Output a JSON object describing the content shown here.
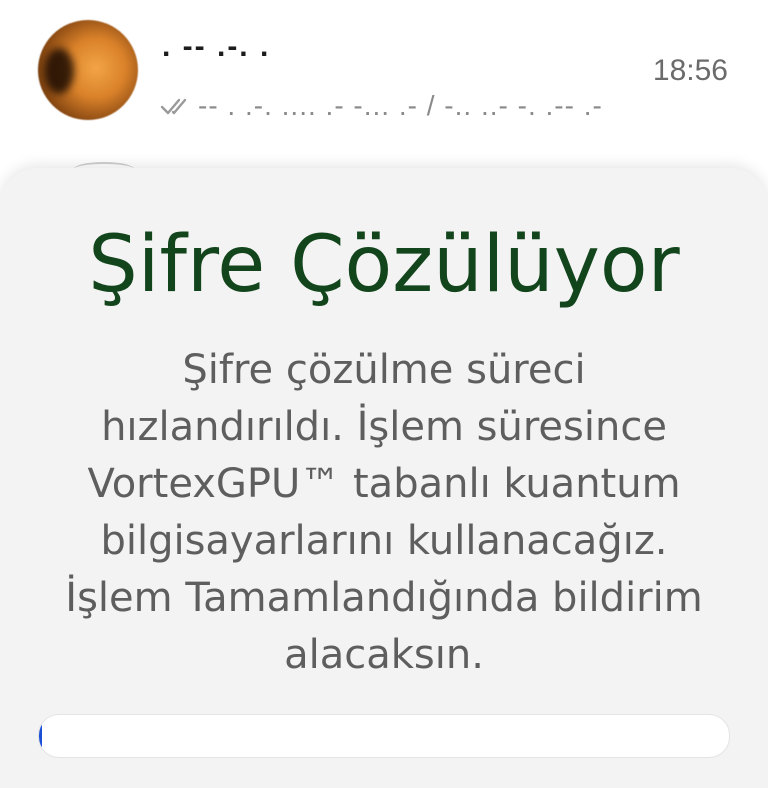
{
  "chat": {
    "contact_name": ". -- .-. .",
    "time": "18:56",
    "read_receipt_icon": "double-check-icon",
    "last_message": "-- . .-. .... .- -... .- / -.. ..- -. .-- .-"
  },
  "modal": {
    "title": "Şifre Çözülüyor",
    "body_lines": [
      "Şifre çözülme süreci",
      "hızlandırıldı. İşlem süresince",
      "VortexGPU™ tabanlı kuantum",
      "bilgisayarlarını kullanacağız.",
      "İşlem Tamamlandığında bildirim",
      "alacaksın."
    ],
    "progress": 0.005
  },
  "colors": {
    "title": "#12451c",
    "body_text": "#5e5e5e",
    "sheet_background": "#f3f3f3",
    "progress_fill": "#1b4fd6",
    "time": "#6b6b6b"
  }
}
